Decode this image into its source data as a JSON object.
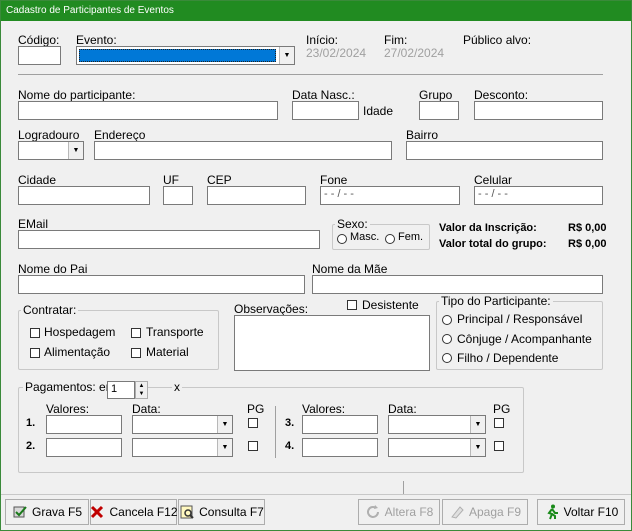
{
  "window": {
    "title": "Cadastro de Participantes de Eventos"
  },
  "header": {
    "codigo_label": "Código:",
    "evento_label": "Evento:",
    "inicio_label": "Início:",
    "inicio_value": "23/02/2024",
    "fim_label": "Fim:",
    "fim_value": "27/02/2024",
    "publico_label": "Público alvo:"
  },
  "participant": {
    "nome_label": "Nome do participante:",
    "data_nasc_label": "Data Nasc.:",
    "idade_label": "Idade",
    "grupo_label": "Grupo",
    "desconto_label": "Desconto:",
    "logradouro_label": "Logradouro",
    "endereco_label": "Endereço",
    "bairro_label": "Bairro",
    "cidade_label": "Cidade",
    "uf_label": "UF",
    "cep_label": "CEP",
    "fone_label": "Fone",
    "fone_mask": "-  -    /  -  -",
    "celular_label": "Celular",
    "celular_mask": "-  -    /  -  -",
    "email_label": "EMail",
    "pai_label": "Nome do Pai",
    "mae_label": "Nome da Mãe"
  },
  "sexo": {
    "label": "Sexo:",
    "masc": "Masc.",
    "fem": "Fem."
  },
  "valores": {
    "inscricao_label": "Valor da Inscrição:",
    "inscricao_value": "R$ 0,00",
    "total_label": "Valor total do grupo:",
    "total_value": "R$ 0,00"
  },
  "contratar": {
    "title": "Contratar:",
    "hospedagem": "Hospedagem",
    "transporte": "Transporte",
    "alimentacao": "Alimentação",
    "material": "Material"
  },
  "observacoes": {
    "label": "Observações:",
    "desistente": "Desistente"
  },
  "tipo": {
    "title": "Tipo do Participante:",
    "opt1": "Principal / Responsável",
    "opt2": "Cônjuge / Acompanhante",
    "opt3": "Filho / Dependente"
  },
  "pagamentos": {
    "title": "Pagamentos: em",
    "count": "1",
    "x": "x",
    "valores_label": "Valores:",
    "data_label": "Data:",
    "pg_label": "PG",
    "row1": "1.",
    "row2": "2.",
    "row3": "3.",
    "row4": "4."
  },
  "buttons": {
    "grava": "Grava F5",
    "cancela": "Cancela F12",
    "consulta": "Consulta F7",
    "altera": "Altera F8",
    "apaga": "Apaga F9",
    "voltar": "Voltar F10"
  },
  "colors": {
    "titlebar": "#218b21",
    "selection": "#0078d7"
  }
}
